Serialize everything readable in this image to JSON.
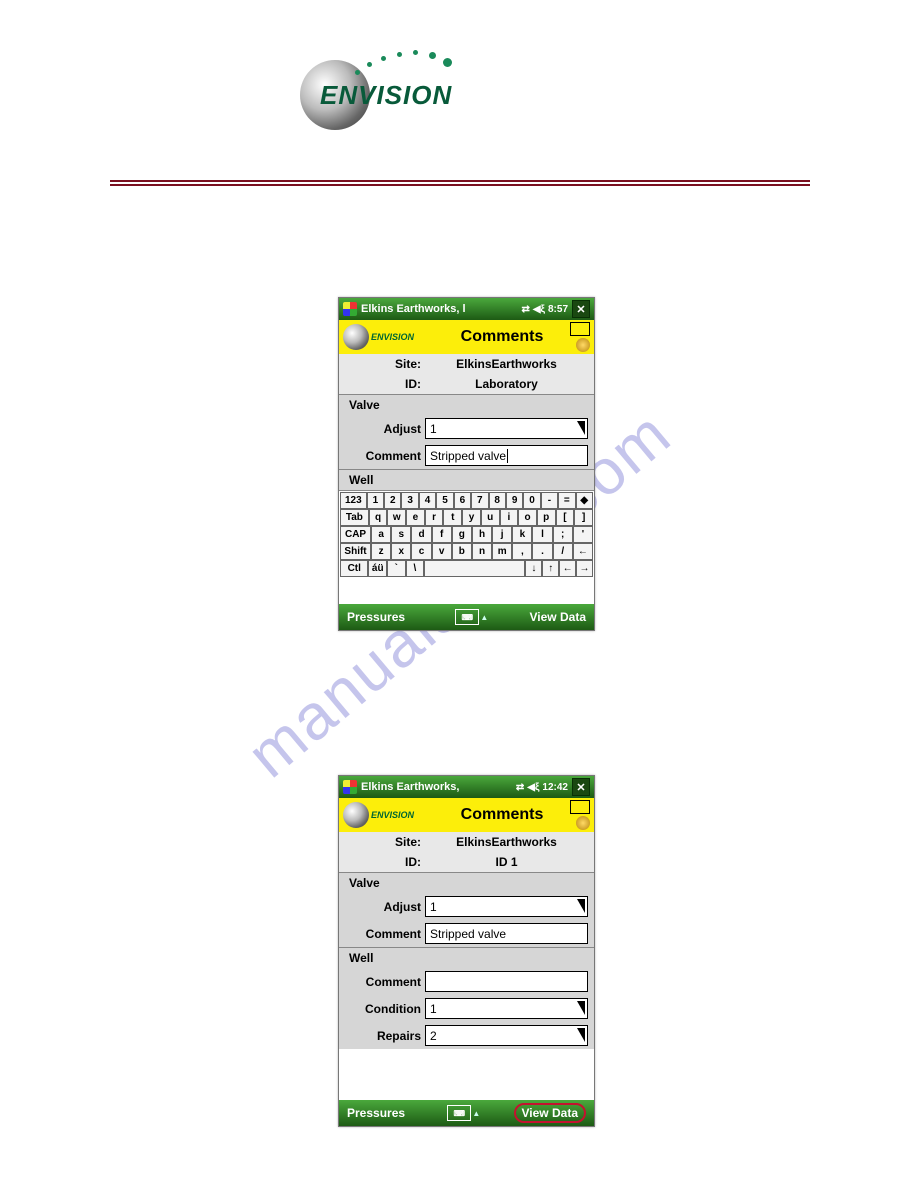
{
  "brand": "ENVISION",
  "watermark": "manualshive.com",
  "screen1": {
    "titlebar": {
      "app": "Elkins Earthworks, l",
      "time": "8:57"
    },
    "banner": {
      "title": "Comments"
    },
    "site": {
      "label": "Site:",
      "value": "ElkinsEarthworks"
    },
    "id": {
      "label": "ID:",
      "value": "Laboratory"
    },
    "valve_section": "Valve",
    "adjust": {
      "label": "Adjust",
      "value": "1"
    },
    "comment": {
      "label": "Comment",
      "value": "Stripped valve"
    },
    "well_section": "Well",
    "keyboard": {
      "r1": [
        "123",
        "1",
        "2",
        "3",
        "4",
        "5",
        "6",
        "7",
        "8",
        "9",
        "0",
        "-",
        "=",
        "◆"
      ],
      "r2": [
        "Tab",
        "q",
        "w",
        "e",
        "r",
        "t",
        "y",
        "u",
        "i",
        "o",
        "p",
        "[",
        "]"
      ],
      "r3": [
        "CAP",
        "a",
        "s",
        "d",
        "f",
        "g",
        "h",
        "j",
        "k",
        "l",
        ";",
        "'"
      ],
      "r4": [
        "Shift",
        "z",
        "x",
        "c",
        "v",
        "b",
        "n",
        "m",
        ",",
        ".",
        "/",
        "←"
      ],
      "r5": [
        "Ctl",
        "áü",
        "`",
        "\\",
        " ",
        "↓",
        "↑",
        "←",
        "→"
      ]
    },
    "softleft": "Pressures",
    "softright": "View Data"
  },
  "screen2": {
    "titlebar": {
      "app": "Elkins Earthworks,",
      "time": "12:42"
    },
    "banner": {
      "title": "Comments"
    },
    "site": {
      "label": "Site:",
      "value": "ElkinsEarthworks"
    },
    "id": {
      "label": "ID:",
      "value": "ID 1"
    },
    "valve_section": "Valve",
    "adjust": {
      "label": "Adjust",
      "value": "1"
    },
    "comment": {
      "label": "Comment",
      "value": "Stripped valve"
    },
    "well_section": "Well",
    "well_comment": {
      "label": "Comment",
      "value": ""
    },
    "condition": {
      "label": "Condition",
      "value": "1"
    },
    "repairs": {
      "label": "Repairs",
      "value": "2"
    },
    "softleft": "Pressures",
    "softright": "View Data"
  }
}
